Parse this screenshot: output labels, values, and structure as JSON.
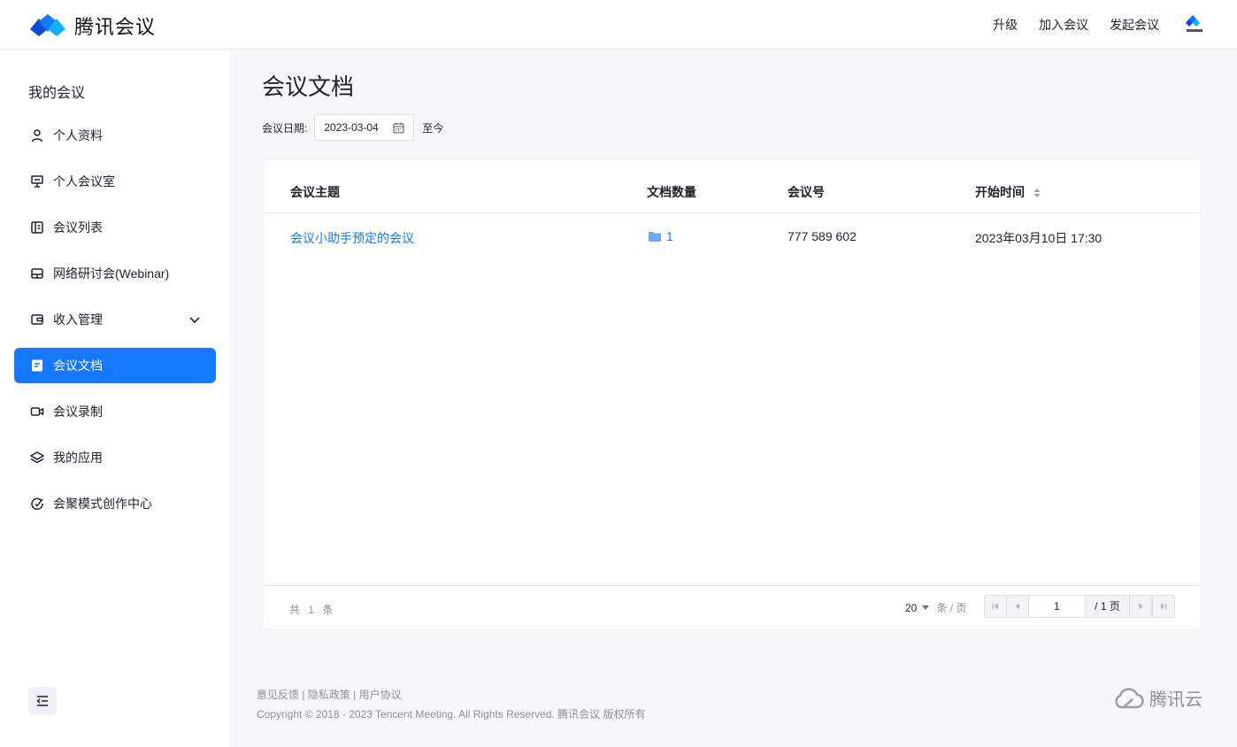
{
  "app": {
    "logo_text": "腾讯会议",
    "top_nav": [
      "升级",
      "加入会议",
      "发起会议"
    ]
  },
  "sidebar": {
    "title": "我的会议",
    "items": [
      {
        "label": "个人资料",
        "icon": "user-icon"
      },
      {
        "label": "个人会议室",
        "icon": "meeting-room-icon"
      },
      {
        "label": "会议列表",
        "icon": "list-icon"
      },
      {
        "label": "网络研讨会(Webinar)",
        "icon": "webinar-icon"
      },
      {
        "label": "收入管理",
        "icon": "wallet-icon"
      },
      {
        "label": "会议文档",
        "icon": "document-icon",
        "active": true
      },
      {
        "label": "会议录制",
        "icon": "video-icon"
      },
      {
        "label": "我的应用",
        "icon": "layers-icon"
      },
      {
        "label": "会聚模式创作中心",
        "icon": "creation-icon"
      }
    ]
  },
  "main": {
    "title": "会议文档",
    "filter": {
      "label": "会议日期:",
      "date": "2023-03-04",
      "to": "至今"
    },
    "table": {
      "headers": [
        "会议主题",
        "文档数量",
        "会议号",
        "开始时间"
      ],
      "rows": [
        {
          "topic": "会议小助手预定的会议",
          "doc_count": "1",
          "meeting_id": "777 589 602",
          "start_time": "2023年03月10日 17:30"
        }
      ]
    },
    "pagination": {
      "total": "共 1 条",
      "page_size": "20",
      "page_size_unit": "条 / 页",
      "current_page": "1",
      "total_pages": "/ 1 页"
    }
  },
  "footer": {
    "links": "意见反馈 | 隐私政策 | 用户协议",
    "copyright": "Copyright © 2018 - 2023 Tencent Meeting. All Rights Reserved. 腾讯会议 版权所有",
    "cloud_text": "腾讯云"
  },
  "colors": {
    "accent": "#1677ff",
    "text": "#1f2329",
    "muted": "#8a9099"
  }
}
